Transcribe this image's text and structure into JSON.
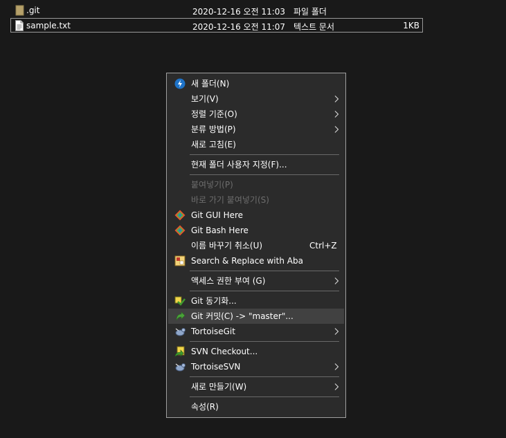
{
  "files": [
    {
      "name": ".git",
      "date": "2020-12-16 오전 11:03",
      "type": "파일 폴더",
      "size": "",
      "icon": "folder-icon"
    },
    {
      "name": "sample.txt",
      "date": "2020-12-16 오전 11:07",
      "type": "텍스트 문서",
      "size": "1KB",
      "icon": "text-file-icon"
    }
  ],
  "menu": {
    "new_folder": "새 폴더(N)",
    "view": "보기(V)",
    "sort_by": "정렬 기준(O)",
    "group_by": "분류 방법(P)",
    "refresh": "새로 고침(E)",
    "customize_folder": "현재 폴더 사용자 지정(F)...",
    "paste": "붙여넣기(P)",
    "paste_shortcut": "바로 가기 붙여넣기(S)",
    "git_gui": "Git GUI Here",
    "git_bash": "Git Bash Here",
    "undo_rename": "이름 바꾸기 취소(U)",
    "undo_rename_shortcut": "Ctrl+Z",
    "search_replace": "Search & Replace with Aba",
    "give_access": "액세스 권한 부여 (G)",
    "git_sync": "Git 동기화...",
    "git_commit": "Git 커밋(C) -> \"master\"...",
    "tortoisegit": "TortoiseGit",
    "svn_checkout": "SVN Checkout...",
    "tortoisesvn": "TortoiseSVN",
    "new": "새로 만들기(W)",
    "properties": "속성(R)"
  },
  "colors": {
    "background": "#191919",
    "menu_background": "#2b2b2b",
    "menu_border": "#a0a0a0",
    "hover": "#414141",
    "disabled_text": "#6d6d6d"
  }
}
